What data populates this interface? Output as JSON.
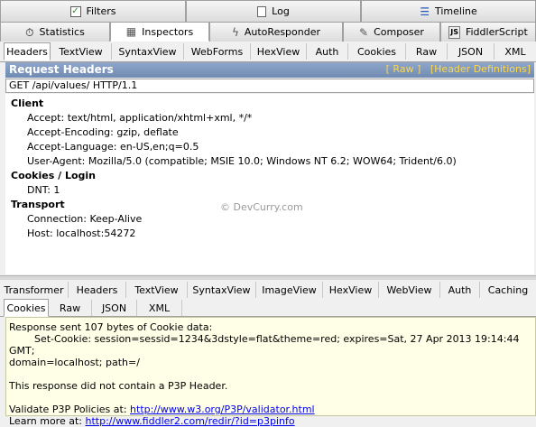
{
  "top_tabs_row1": [
    {
      "label": "Filters",
      "icon": "checkbox-icon"
    },
    {
      "label": "Log",
      "icon": "log-icon"
    },
    {
      "label": "Timeline",
      "icon": "timeline-icon"
    }
  ],
  "top_tabs_row2": [
    {
      "label": "Statistics",
      "icon": "stopwatch-icon"
    },
    {
      "label": "Inspectors",
      "icon": "inspector-icon"
    },
    {
      "label": "AutoResponder",
      "icon": "lightning-icon"
    },
    {
      "label": "Composer",
      "icon": "composer-icon"
    },
    {
      "label": "FiddlerScript",
      "icon": "js-icon"
    }
  ],
  "request_tabs": [
    "Headers",
    "TextView",
    "SyntaxView",
    "WebForms",
    "HexView",
    "Auth",
    "Cookies",
    "Raw",
    "JSON",
    "XML"
  ],
  "request_headers": {
    "title": "Request Headers",
    "raw_link": "[ Raw ]",
    "defs_link": "[Header Definitions]",
    "request_line": "GET /api/values/ HTTP/1.1",
    "groups": [
      {
        "name": "Client",
        "items": [
          "Accept: text/html, application/xhtml+xml, */*",
          "Accept-Encoding: gzip, deflate",
          "Accept-Language: en-US,en;q=0.5",
          "User-Agent: Mozilla/5.0 (compatible; MSIE 10.0; Windows NT 6.2; WOW64; Trident/6.0)"
        ]
      },
      {
        "name": "Cookies / Login",
        "items": [
          "DNT: 1"
        ]
      },
      {
        "name": "Transport",
        "items": [
          "Connection: Keep-Alive",
          "Host: localhost:54272"
        ]
      }
    ]
  },
  "watermark": "© DevCurry.com",
  "response_tabs_row1": [
    "Transformer",
    "Headers",
    "TextView",
    "SyntaxView",
    "ImageView",
    "HexView",
    "WebView",
    "Auth",
    "Caching"
  ],
  "response_tabs_row2": [
    "Cookies",
    "Raw",
    "JSON",
    "XML"
  ],
  "response": {
    "line1": "Response sent 107 bytes of Cookie data:",
    "line2": "        Set-Cookie: session=sessid=1234&3dstyle=flat&theme=red; expires=Sat, 27 Apr 2013 19:14:44 GMT;",
    "line3": "domain=localhost; path=/",
    "line4": "This response did not contain a P3P Header.",
    "validate_prefix": "Validate P3P Policies at: ",
    "validate_link": "http://www.w3.org/P3P/validator.html",
    "learn_prefix": "Learn more at: ",
    "learn_link": "http://www.fiddler2.com/redir/?id=p3pinfo"
  }
}
